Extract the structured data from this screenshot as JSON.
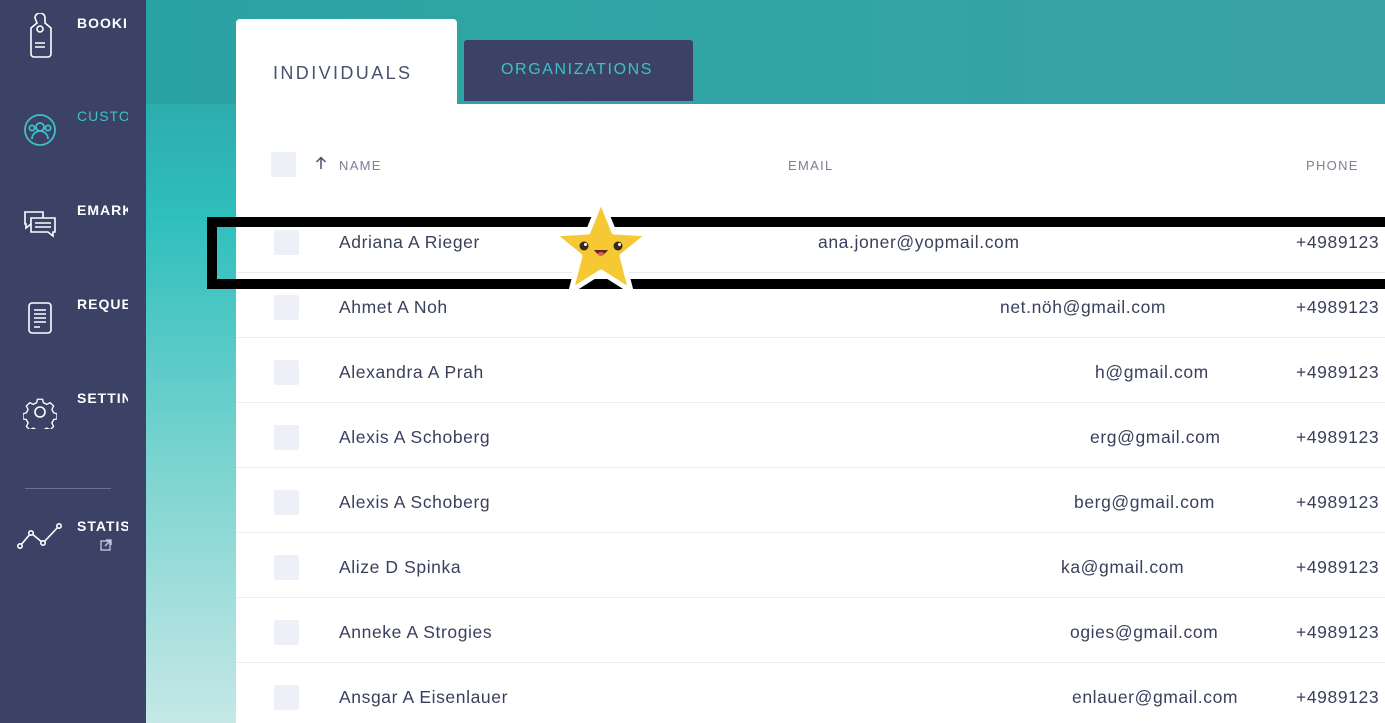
{
  "sidebar": {
    "items": [
      {
        "label": "BOOKINGS",
        "icon": "door-hanger-icon"
      },
      {
        "label": "CUSTOMERS",
        "icon": "customers-icon"
      },
      {
        "label": "EMARKETING",
        "icon": "chat-icon"
      },
      {
        "label": "REQUESTS",
        "icon": "request-form-icon"
      },
      {
        "label": "SETTINGS",
        "icon": "gear-icon"
      },
      {
        "label": "STATISTICS",
        "icon": "line-graph-icon"
      }
    ],
    "active": 1,
    "external_icon": "external-link-icon"
  },
  "tabs": {
    "individuals": "INDIVIDUALS",
    "organizations": "ORGANIZATIONS"
  },
  "table": {
    "columns": {
      "name": "NAME",
      "email": "EMAIL",
      "phone": "PHONE"
    },
    "sort_icon": "arrow-up-icon",
    "rows": [
      {
        "name": "Adriana A Rieger",
        "email": "ana.joner@yopmail.com",
        "phone": "+4989123"
      },
      {
        "name": "Ahmet A Noh",
        "email": "net.nöh@gmail.com",
        "phone": "+4989123"
      },
      {
        "name": "Alexandra A Prah",
        "email": "h@gmail.com",
        "phone": "+4989123"
      },
      {
        "name": "Alexis A Schoberg",
        "email": "erg@gmail.com",
        "phone": "+4989123"
      },
      {
        "name": "Alexis A Schoberg",
        "email": "berg@gmail.com",
        "phone": "+4989123"
      },
      {
        "name": "Alize D Spinka",
        "email": "ka@gmail.com",
        "phone": "+4989123"
      },
      {
        "name": "Anneke A Strogies",
        "email": "ogies@gmail.com",
        "phone": "+4989123"
      },
      {
        "name": "Ansgar A Eisenlauer",
        "email": "enlauer@gmail.com",
        "phone": "+4989123"
      }
    ]
  },
  "overlay": {
    "sticker_icon": "star-face-icon"
  },
  "colors": {
    "sidebar": "#3b4266",
    "accent": "#3ec1c6",
    "text": "#3a3f5c"
  }
}
